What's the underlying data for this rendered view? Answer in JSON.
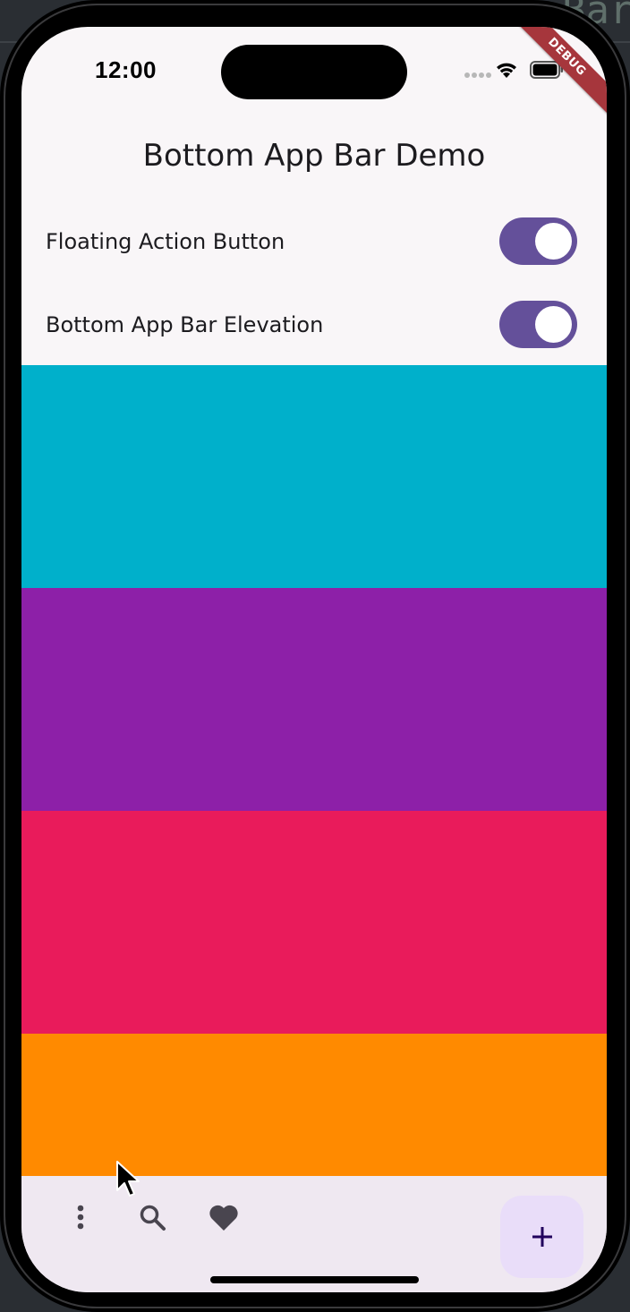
{
  "background": {
    "code_text": "Bar"
  },
  "status_bar": {
    "time": "12:00",
    "debug_banner": "DEBUG"
  },
  "app_bar": {
    "title": "Bottom App Bar Demo"
  },
  "settings": [
    {
      "label": "Floating Action Button",
      "enabled": true
    },
    {
      "label": "Bottom App Bar Elevation",
      "enabled": true
    }
  ],
  "colors": {
    "accent": "#64509a",
    "blocks": [
      "#00b0cb",
      "#8d20a8",
      "#e91b5b",
      "#ff8a00"
    ]
  },
  "bottom_bar": {
    "icons": [
      "more-vert-icon",
      "search-icon",
      "favorite-icon"
    ],
    "fab_icon": "add-icon"
  }
}
